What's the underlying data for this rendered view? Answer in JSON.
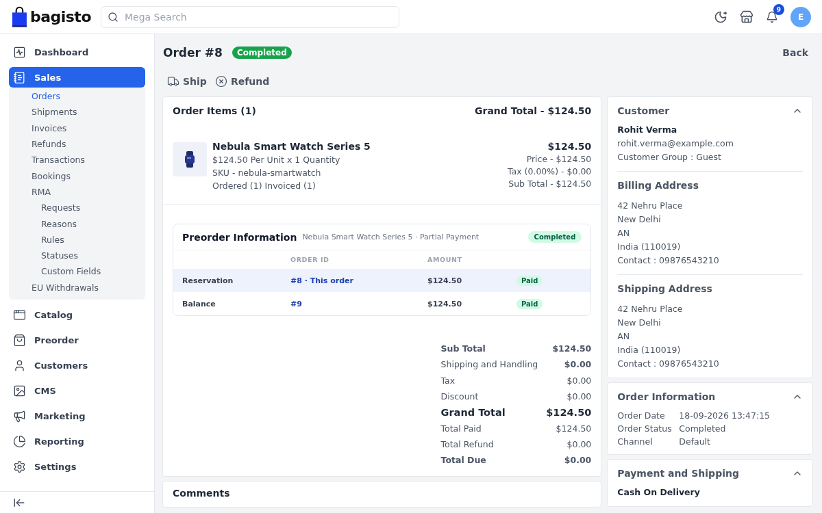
{
  "brand": {
    "name": "bagisto"
  },
  "search": {
    "placeholder": "Mega Search"
  },
  "notifications": {
    "count": "9"
  },
  "user": {
    "initial": "E"
  },
  "sidebar": {
    "items": [
      {
        "label": "Dashboard",
        "selected": false
      },
      {
        "label": "Sales",
        "selected": true,
        "expanded": true,
        "children": [
          {
            "label": "Orders",
            "selected": true
          },
          {
            "label": "Shipments",
            "selected": false
          },
          {
            "label": "Invoices",
            "selected": false
          },
          {
            "label": "Refunds",
            "selected": false
          },
          {
            "label": "Transactions",
            "selected": false
          },
          {
            "label": "Bookings",
            "selected": false
          },
          {
            "label": "RMA",
            "selected": false,
            "children": [
              {
                "label": "Requests",
                "selected": false
              },
              {
                "label": "Reasons",
                "selected": false
              },
              {
                "label": "Rules",
                "selected": false
              },
              {
                "label": "Statuses",
                "selected": false
              },
              {
                "label": "Custom Fields",
                "selected": false
              }
            ]
          },
          {
            "label": "EU Withdrawals",
            "selected": false
          }
        ]
      },
      {
        "label": "Catalog",
        "selected": false
      },
      {
        "label": "Preorder",
        "selected": false
      },
      {
        "label": "Customers",
        "selected": false
      },
      {
        "label": "CMS",
        "selected": false
      },
      {
        "label": "Marketing",
        "selected": false
      },
      {
        "label": "Reporting",
        "selected": false
      },
      {
        "label": "Settings",
        "selected": false
      }
    ]
  },
  "order": {
    "title": "Order #8",
    "status": "Completed",
    "back": "Back",
    "actions": [
      "Ship",
      "Refund"
    ]
  },
  "items_card": {
    "title": "Order Items (1)",
    "grand_total": "Grand Total - $124.50",
    "items": [
      {
        "kind": "picture",
        "name": "Nebula Smart Watch Series 5",
        "details": [
          "$124.50 Per Unit x 1 Quantity",
          "SKU - nebula-smartwatch",
          "Ordered (1) Invoiced (1)"
        ],
        "total": "$124.50",
        "breakdown": [
          "Price - $124.50",
          "Tax (0.00%) - $0.00",
          "Sub Total - $124.50"
        ]
      }
    ]
  },
  "preorder": {
    "title": "Preorder Information",
    "subtitle": "Nebula Smart Watch Series 5 · Partial Payment",
    "status": "Completed",
    "columns": [
      "ORDER ID",
      "AMOUNT"
    ],
    "rows": [
      {
        "label": "Reservation",
        "order_id": "#8 · This order",
        "amount": "$124.50",
        "status": "Paid",
        "highlighted": true
      },
      {
        "label": "Balance",
        "order_id": "#9",
        "amount": "$124.50",
        "status": "Paid",
        "highlighted": false
      }
    ]
  },
  "totals": [
    {
      "label": "Sub Total",
      "value": "$124.50",
      "kind": "bold"
    },
    {
      "label": "Shipping and Handling",
      "value": "$0.00",
      "kind": "value-bold"
    },
    {
      "label": "Tax",
      "value": "$0.00",
      "kind": "plain"
    },
    {
      "label": "Discount",
      "value": "$0.00",
      "kind": "plain"
    },
    {
      "label": "Grand Total",
      "value": "$124.50",
      "kind": "grand"
    },
    {
      "label": "Total Paid",
      "value": "$124.50",
      "kind": "plain"
    },
    {
      "label": "Total Refund",
      "value": "$0.00",
      "kind": "plain"
    },
    {
      "label": "Total Due",
      "value": "$0.00",
      "kind": "bold"
    }
  ],
  "comments": {
    "title": "Comments"
  },
  "customer": {
    "title": "Customer",
    "expanded": true,
    "name": "Rohit Verma",
    "email": "rohit.verma@example.com",
    "group": "Customer Group : Guest"
  },
  "billing_address": {
    "title": "Billing Address",
    "lines": [
      "42 Nehru Place",
      "New Delhi",
      "AN",
      "India (110019)",
      "Contact : 09876543210"
    ]
  },
  "shipping_address": {
    "title": "Shipping Address",
    "lines": [
      "42 Nehru Place",
      "New Delhi",
      "AN",
      "India (110019)",
      "Contact : 09876543210"
    ]
  },
  "order_information": {
    "title": "Order Information",
    "expanded": true,
    "rows": [
      {
        "label": "Order Date",
        "value": "18-09-2026 13:47:15"
      },
      {
        "label": "Order Status",
        "value": "Completed"
      },
      {
        "label": "Channel",
        "value": "Default"
      }
    ]
  },
  "payment_shipping": {
    "title": "Payment and Shipping",
    "expanded": true,
    "method": "Cash On Delivery"
  }
}
